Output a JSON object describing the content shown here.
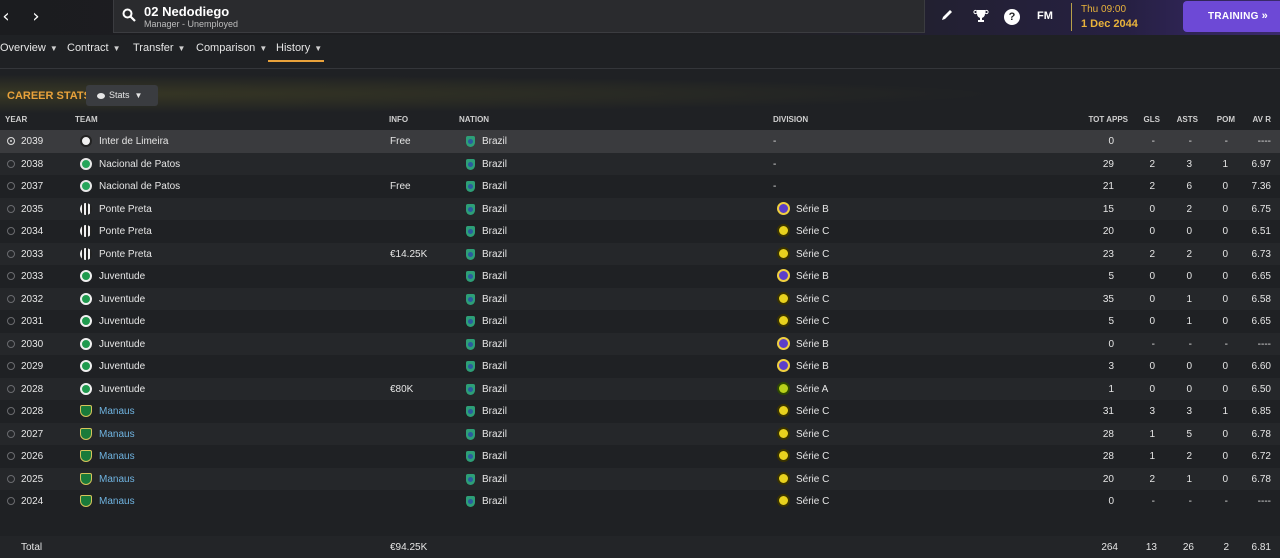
{
  "header": {
    "back_icon": "chevron-left-icon",
    "forward_icon": "chevron-right-icon",
    "search_title": "02 Nedodiego",
    "search_subtitle": "Manager - Unemployed",
    "date_day": "Thu 09:00",
    "date": "1 Dec 2044",
    "fm_logo": "FM",
    "help": "?",
    "training_label": "TRAINING",
    "training_chevron": "»",
    "accent": "#6d49d6"
  },
  "tabs": [
    {
      "label": "Overview"
    },
    {
      "label": "Contract"
    },
    {
      "label": "Transfer"
    },
    {
      "label": "Comparison"
    },
    {
      "label": "History",
      "active": true
    }
  ],
  "career": {
    "title": "CAREER STATS",
    "stats_button": "Stats",
    "title_color": "#e9a23b"
  },
  "columns": {
    "year": "YEAR",
    "team": "TEAM",
    "info": "INFO",
    "nation": "NATION",
    "division": "DIVISION",
    "apps": "TOT APPS",
    "gls": "GLS",
    "asts": "ASTS",
    "pom": "POM",
    "avr": "AV R"
  },
  "rows": [
    {
      "year": "2039",
      "team": "Inter de Limeira",
      "badge": "inter",
      "link": false,
      "info": "Free",
      "nation": "Brazil",
      "division": "-",
      "div": "",
      "apps": "0",
      "gls": "-",
      "asts": "-",
      "pom": "-",
      "avr": "----"
    },
    {
      "year": "2038",
      "team": "Nacional de Patos",
      "badge": "nacional",
      "link": false,
      "info": "",
      "nation": "Brazil",
      "division": "-",
      "div": "",
      "apps": "29",
      "gls": "2",
      "asts": "3",
      "pom": "1",
      "avr": "6.97"
    },
    {
      "year": "2037",
      "team": "Nacional de Patos",
      "badge": "nacional",
      "link": false,
      "info": "Free",
      "nation": "Brazil",
      "division": "-",
      "div": "",
      "apps": "21",
      "gls": "2",
      "asts": "6",
      "pom": "0",
      "avr": "7.36"
    },
    {
      "year": "2035",
      "team": "Ponte Preta",
      "badge": "ponte",
      "link": false,
      "info": "",
      "nation": "Brazil",
      "division": "Série B",
      "div": "b",
      "apps": "15",
      "gls": "0",
      "asts": "2",
      "pom": "0",
      "avr": "6.75"
    },
    {
      "year": "2034",
      "team": "Ponte Preta",
      "badge": "ponte",
      "link": false,
      "info": "",
      "nation": "Brazil",
      "division": "Série C",
      "div": "c",
      "apps": "20",
      "gls": "0",
      "asts": "0",
      "pom": "0",
      "avr": "6.51"
    },
    {
      "year": "2033",
      "team": "Ponte Preta",
      "badge": "ponte",
      "link": false,
      "info": "€14.25K",
      "nation": "Brazil",
      "division": "Série C",
      "div": "c",
      "apps": "23",
      "gls": "2",
      "asts": "2",
      "pom": "0",
      "avr": "6.73"
    },
    {
      "year": "2033",
      "team": "Juventude",
      "badge": "juv",
      "link": false,
      "info": "",
      "nation": "Brazil",
      "division": "Série B",
      "div": "b",
      "apps": "5",
      "gls": "0",
      "asts": "0",
      "pom": "0",
      "avr": "6.65"
    },
    {
      "year": "2032",
      "team": "Juventude",
      "badge": "juv",
      "link": false,
      "info": "",
      "nation": "Brazil",
      "division": "Série C",
      "div": "c",
      "apps": "35",
      "gls": "0",
      "asts": "1",
      "pom": "0",
      "avr": "6.58"
    },
    {
      "year": "2031",
      "team": "Juventude",
      "badge": "juv",
      "link": false,
      "info": "",
      "nation": "Brazil",
      "division": "Série C",
      "div": "c",
      "apps": "5",
      "gls": "0",
      "asts": "1",
      "pom": "0",
      "avr": "6.65"
    },
    {
      "year": "2030",
      "team": "Juventude",
      "badge": "juv",
      "link": false,
      "info": "",
      "nation": "Brazil",
      "division": "Série B",
      "div": "b",
      "apps": "0",
      "gls": "-",
      "asts": "-",
      "pom": "-",
      "avr": "----"
    },
    {
      "year": "2029",
      "team": "Juventude",
      "badge": "juv",
      "link": false,
      "info": "",
      "nation": "Brazil",
      "division": "Série B",
      "div": "b",
      "apps": "3",
      "gls": "0",
      "asts": "0",
      "pom": "0",
      "avr": "6.60"
    },
    {
      "year": "2028",
      "team": "Juventude",
      "badge": "juv",
      "link": false,
      "info": "€80K",
      "nation": "Brazil",
      "division": "Série A",
      "div": "a",
      "apps": "1",
      "gls": "0",
      "asts": "0",
      "pom": "0",
      "avr": "6.50"
    },
    {
      "year": "2028",
      "team": "Manaus",
      "badge": "manaus",
      "link": true,
      "info": "",
      "nation": "Brazil",
      "division": "Série C",
      "div": "c",
      "apps": "31",
      "gls": "3",
      "asts": "3",
      "pom": "1",
      "avr": "6.85"
    },
    {
      "year": "2027",
      "team": "Manaus",
      "badge": "manaus",
      "link": true,
      "info": "",
      "nation": "Brazil",
      "division": "Série C",
      "div": "c",
      "apps": "28",
      "gls": "1",
      "asts": "5",
      "pom": "0",
      "avr": "6.78"
    },
    {
      "year": "2026",
      "team": "Manaus",
      "badge": "manaus",
      "link": true,
      "info": "",
      "nation": "Brazil",
      "division": "Série C",
      "div": "c",
      "apps": "28",
      "gls": "1",
      "asts": "2",
      "pom": "0",
      "avr": "6.72"
    },
    {
      "year": "2025",
      "team": "Manaus",
      "badge": "manaus",
      "link": true,
      "info": "",
      "nation": "Brazil",
      "division": "Série C",
      "div": "c",
      "apps": "20",
      "gls": "2",
      "asts": "1",
      "pom": "0",
      "avr": "6.78"
    },
    {
      "year": "2024",
      "team": "Manaus",
      "badge": "manaus",
      "link": true,
      "info": "",
      "nation": "Brazil",
      "division": "Série C",
      "div": "c",
      "apps": "0",
      "gls": "-",
      "asts": "-",
      "pom": "-",
      "avr": "----"
    }
  ],
  "total": {
    "label": "Total",
    "info": "€94.25K",
    "apps": "264",
    "gls": "13",
    "asts": "26",
    "pom": "2",
    "avr": "6.81"
  }
}
